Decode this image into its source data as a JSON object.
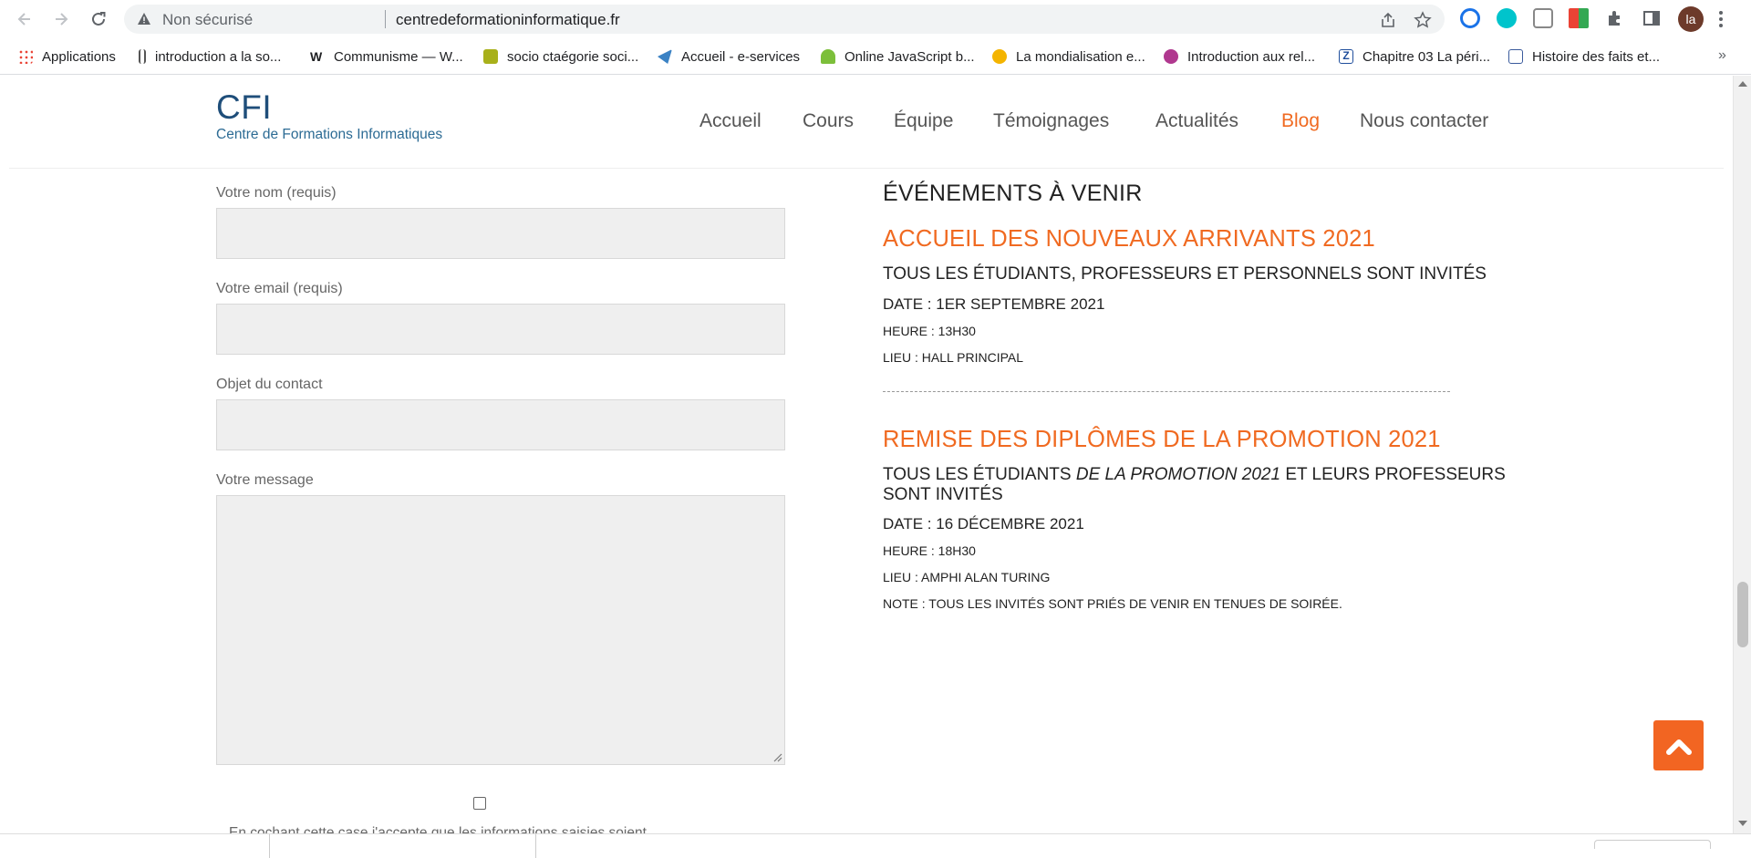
{
  "browser": {
    "security_label": "Non sécurisé",
    "url": "centredeformationinformatique.fr",
    "profile_initials": "la",
    "bookmarks": [
      {
        "label": "Applications",
        "color": "#4285f4"
      },
      {
        "label": "introduction a la so...",
        "color": "#555555"
      },
      {
        "label": "Communisme — W...",
        "color": "#222222"
      },
      {
        "label": "socio ctaégorie soci...",
        "color": "#a8b01a"
      },
      {
        "label": "Accueil - e-services",
        "color": "#3b82c4"
      },
      {
        "label": "Online JavaScript b...",
        "color": "#7cbf3a"
      },
      {
        "label": "La mondialisation e...",
        "color": "#f4b400"
      },
      {
        "label": "Introduction aux rel...",
        "color": "#b0388f"
      },
      {
        "label": "Chapitre 03 La péri...",
        "color": "#1f4e9c"
      },
      {
        "label": "Histoire des faits et...",
        "color": "#3a5a9c"
      }
    ],
    "more": "»"
  },
  "site": {
    "logo": "CFI",
    "tagline": "Centre de Formations Informatiques",
    "menu": [
      "Accueil",
      "Cours",
      "Équipe",
      "Témoignages",
      "Actualités",
      "Blog",
      "Nous contacter"
    ],
    "active_menu": "Blog",
    "accent_color": "#f06a21"
  },
  "form": {
    "name_label": "Votre nom (requis)",
    "email_label": "Votre email (requis)",
    "subject_label": "Objet du contact",
    "message_label": "Votre message",
    "consent_text": "En cochant cette case j'accepte que les informations saisies soient"
  },
  "events": {
    "heading": "ÉVÉNEMENTS À VENIR",
    "items": [
      {
        "title": "ACCUEIL DES NOUVEAUX ARRIVANTS 2021",
        "subtitle": "TOUS LES ÉTUDIANTS, PROFESSEURS ET PERSONNELS SONT INVITÉS",
        "date": "DATE : 1ER SEPTEMBRE 2021",
        "time": "HEURE : 13H30",
        "place": "LIEU : HALL PRINCIPAL"
      },
      {
        "title": "REMISE DES DIPLÔMES DE LA PROMOTION 2021",
        "subtitle_pre": "TOUS LES ÉTUDIANTS ",
        "subtitle_em": "DE LA PROMOTION 2021",
        "subtitle_post": " ET LEURS PROFESSEURS SONT INVITÉS",
        "date": "DATE : 16 DÉCEMBRE 2021",
        "time": "HEURE : 18H30",
        "place": "LIEU : AMPHI ALAN TURING",
        "note": "NOTE : TOUS LES INVITÉS SONT PRIÉS DE VENIR EN TENUES DE SOIRÉE."
      }
    ]
  }
}
